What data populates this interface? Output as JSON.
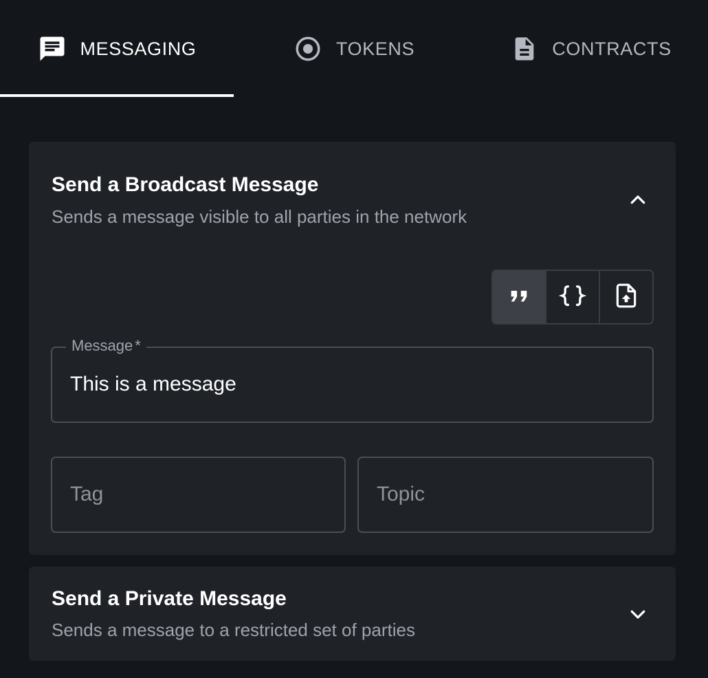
{
  "tabs": [
    {
      "label": "MESSAGING",
      "icon": "message-icon",
      "active": true
    },
    {
      "label": "TOKENS",
      "icon": "token-icon",
      "active": false
    },
    {
      "label": "CONTRACTS",
      "icon": "document-icon",
      "active": false
    }
  ],
  "broadcast": {
    "title": "Send a Broadcast Message",
    "subtitle": "Sends a message visible to all parties in the network",
    "expanded": true,
    "format_options": [
      "quote-icon",
      "braces-icon",
      "file-upload-icon"
    ],
    "selected_format": "quote-icon",
    "message": {
      "label": "Message",
      "required_mark": "*",
      "value": "This is a message"
    },
    "tag": {
      "placeholder": "Tag"
    },
    "topic": {
      "placeholder": "Topic"
    }
  },
  "private": {
    "title": "Send a Private Message",
    "subtitle": "Sends a message to a restricted set of parties",
    "expanded": false
  },
  "colors": {
    "background": "#13161b",
    "panel": "#1f2227",
    "text_primary": "#ffffff",
    "text_secondary": "#9ea4ad",
    "border": "#4a4e56"
  }
}
